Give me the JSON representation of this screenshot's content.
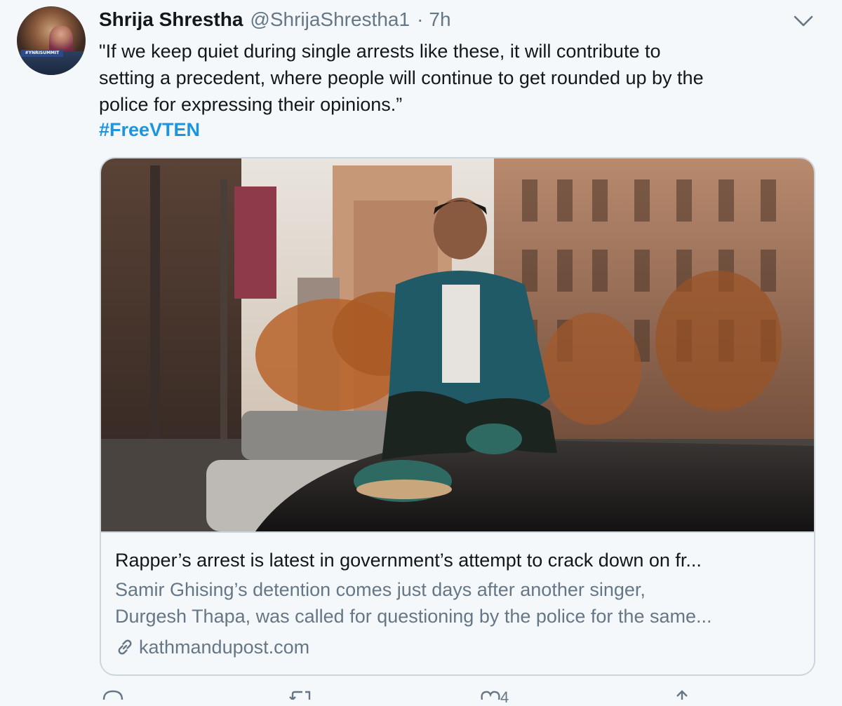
{
  "tweet": {
    "author_name": "Shrija Shrestha",
    "author_handle": "@ShrijaShrestha1",
    "separator": "·",
    "time": "7h",
    "text": "\"If we keep quiet during single arrests like these, it will contribute to\nsetting a precedent, where people will continue to get rounded up by the\npolice for expressing their opinions.”",
    "hashtag": "#FreeVTEN",
    "avatar_banner": "#YNRISUMMIT"
  },
  "card": {
    "title": "Rapper’s arrest is latest in government’s attempt to crack down on fr...",
    "description_lines": [
      "Samir Ghising’s detention comes just days after another singer,",
      "Durgesh Thapa, was called for questioning by the police for the same..."
    ],
    "domain": "kathmandupost.com",
    "icon": "link-icon"
  },
  "actions": {
    "like_count": "4",
    "icons": [
      "reply-icon",
      "retweet-icon",
      "like-icon",
      "share-icon"
    ]
  },
  "colors": {
    "background": "#f5f8fa",
    "text_primary": "#14171a",
    "text_secondary": "#657786",
    "accent": "#1b95e0",
    "border": "#ccd6dd"
  }
}
